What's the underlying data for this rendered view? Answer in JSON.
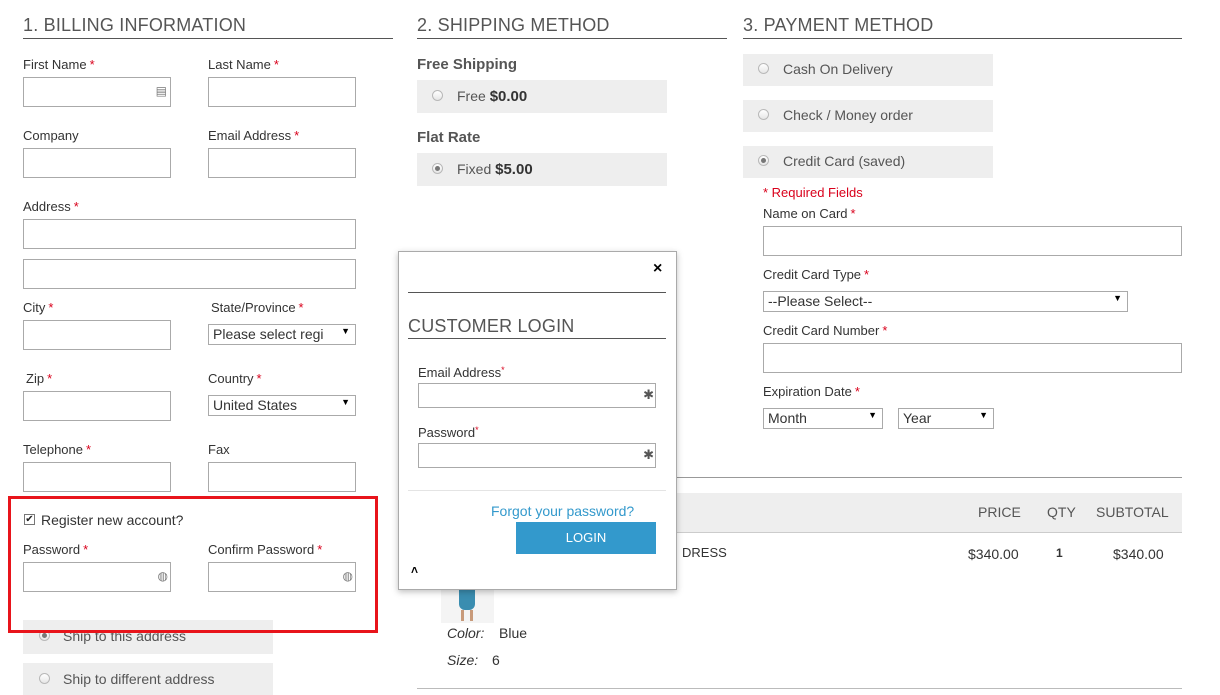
{
  "billing": {
    "title": "1. BILLING INFORMATION",
    "first_name_label": "First Name",
    "last_name_label": "Last Name",
    "company_label": "Company",
    "email_label": "Email Address",
    "address_label": "Address",
    "city_label": "City",
    "state_label": "State/Province",
    "state_value": "Please select regi",
    "zip_label": "Zip",
    "country_label": "Country",
    "country_value": "United States",
    "telephone_label": "Telephone",
    "fax_label": "Fax",
    "register_label": "Register new account?",
    "password_label": "Password",
    "confirm_password_label": "Confirm Password",
    "ship_same_label": "Ship to this address",
    "ship_different_label": "Ship to different address",
    "required_mark": "*"
  },
  "shipping": {
    "title": "2. SHIPPING METHOD",
    "methods": [
      {
        "group": "Free Shipping",
        "label": "Free",
        "price": "$0.00",
        "selected": false
      },
      {
        "group": "Flat Rate",
        "label": "Fixed",
        "price": "$5.00",
        "selected": true
      }
    ]
  },
  "payment": {
    "title": "3. PAYMENT METHOD",
    "options": [
      {
        "label": "Cash On Delivery",
        "selected": false
      },
      {
        "label": "Check / Money order",
        "selected": false
      },
      {
        "label": "Credit Card (saved)",
        "selected": true
      }
    ],
    "required_note": "* Required Fields",
    "name_on_card_label": "Name on Card",
    "card_type_label": "Credit Card Type",
    "card_type_value": "--Please Select--",
    "card_number_label": "Credit Card Number",
    "expiration_label": "Expiration Date",
    "month_value": "Month",
    "year_value": "Year"
  },
  "review": {
    "columns": [
      "PRICE",
      "QTY",
      "SUBTOTAL"
    ],
    "item": {
      "name": "DRESS",
      "price": "$340.00",
      "qty": "1",
      "subtotal": "$340.00",
      "color_label": "Color:",
      "color_value": "Blue",
      "size_label": "Size:",
      "size_value": "6"
    }
  },
  "login_modal": {
    "close_symbol": "×",
    "title": "CUSTOMER LOGIN",
    "email_label": "Email Address",
    "password_label": "Password",
    "forgot_link": "Forgot your password?",
    "login_button": "LOGIN",
    "collapse_symbol": "˄"
  },
  "colors": {
    "highlight_border": "#e8141b",
    "login_button": "#3399cc",
    "link": "#3399cc",
    "required": "#d9001b"
  }
}
